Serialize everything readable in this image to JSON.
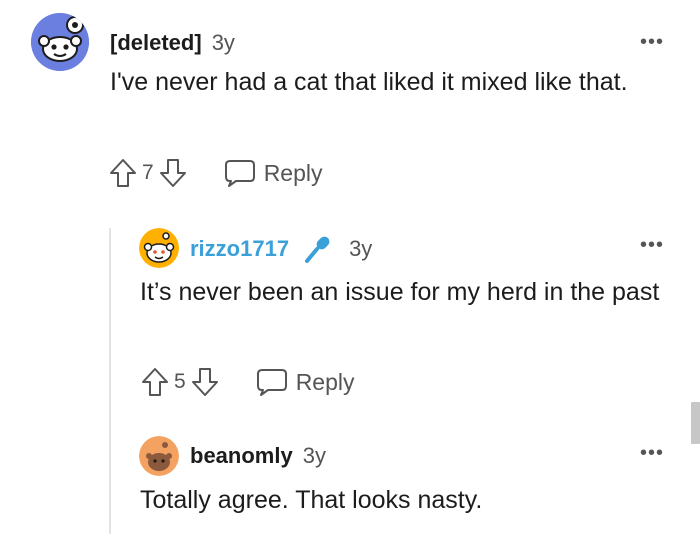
{
  "comments": [
    {
      "author": "[deleted]",
      "age": "3y",
      "text": "I've never had a cat that liked it mixed like that.",
      "score": "7",
      "reply_label": "Reply",
      "more": "•••"
    },
    {
      "author": "rizzo1717",
      "age": "3y",
      "text": "It’s never been an issue for my herd in the past",
      "score": "5",
      "reply_label": "Reply",
      "more": "•••",
      "flair_icon": "microphone-icon"
    },
    {
      "author": "beanomly",
      "age": "3y",
      "text": "Totally agree. That looks nasty.",
      "more": "•••"
    }
  ],
  "colors": {
    "link_author": "#3aa0d8",
    "deleted_avatar_bg": "#6b7fe0",
    "rizzo_avatar_bg": "#ffb000",
    "beanomly_avatar_bg": "#f4a261",
    "thread_line": "#e3e3e3"
  }
}
